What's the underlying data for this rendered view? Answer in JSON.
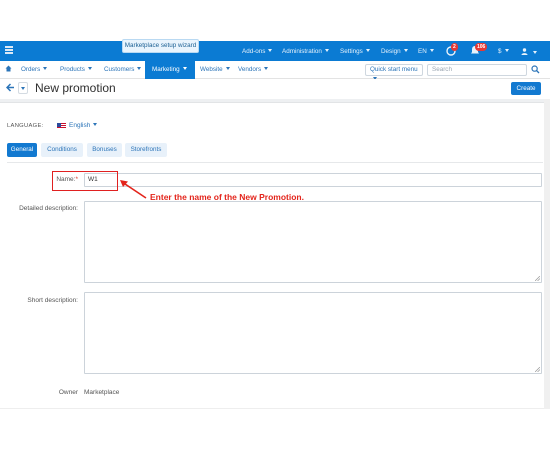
{
  "topbar": {
    "wizard_label": "Marketplace setup wizard",
    "items": [
      "Add-ons",
      "Administration",
      "Settings",
      "Design",
      "EN",
      "$"
    ],
    "notif_badge": "2",
    "messages_badge": "106"
  },
  "nav": {
    "items": [
      "Orders",
      "Products",
      "Customers",
      "Marketing",
      "Website",
      "Vendors"
    ],
    "active": "Marketing",
    "quick_start": "Quick start menu",
    "search_placeholder": "Search"
  },
  "header": {
    "title": "New promotion",
    "create_label": "Create"
  },
  "language": {
    "label": "LANGUAGE:",
    "value": "English"
  },
  "tabs": [
    "General",
    "Conditions",
    "Bonuses",
    "Storefronts"
  ],
  "form": {
    "name_label": "Name:",
    "name_required": "*",
    "name_value": "W1",
    "detailed_label": "Detailed description:",
    "short_label": "Short description:",
    "owner_label": "Owner",
    "owner_value": "Marketplace"
  },
  "annotation": "Enter the name of the New Promotion.",
  "colors": {
    "primary": "#0b7bd3",
    "annotation": "#e3241b"
  }
}
